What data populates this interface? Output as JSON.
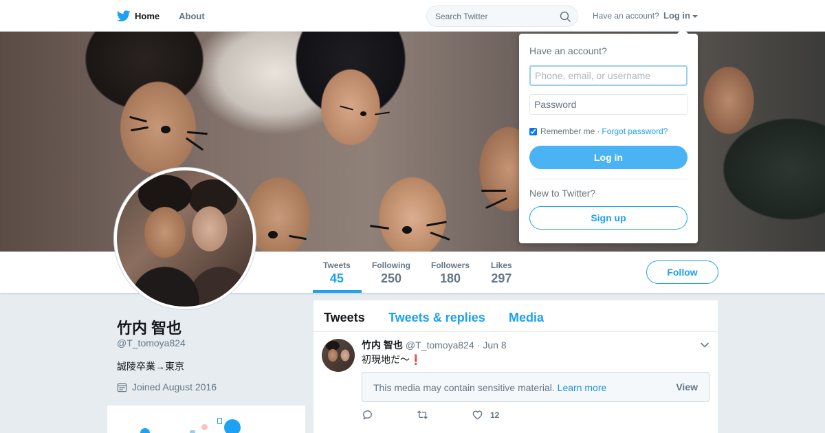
{
  "nav": {
    "home_label": "Home",
    "about_label": "About",
    "search_placeholder": "Search Twitter",
    "have_account": "Have an account?",
    "login_label": "Log in"
  },
  "login_dropdown": {
    "title": "Have an account?",
    "username_placeholder": "Phone, email, or username",
    "password_placeholder": "Password",
    "remember_label": "Remember me",
    "separator": "·",
    "forgot_label": "Forgot password?",
    "login_button": "Log in",
    "new_label": "New to Twitter?",
    "signup_button": "Sign up"
  },
  "profile_nav": {
    "stats": [
      {
        "label": "Tweets",
        "value": "45"
      },
      {
        "label": "Following",
        "value": "250"
      },
      {
        "label": "Followers",
        "value": "180"
      },
      {
        "label": "Likes",
        "value": "297"
      }
    ],
    "follow_button": "Follow"
  },
  "profile": {
    "name": "竹内 智也",
    "handle": "@T_tomoya824",
    "bio": "誠陵卒業→東京",
    "joined": "Joined August 2016"
  },
  "timeline": {
    "tabs": [
      "Tweets",
      "Tweets & replies",
      "Media"
    ]
  },
  "tweet": {
    "name": "竹内 智也",
    "handle": "@T_tomoya824",
    "dot": "·",
    "date": "Jun 8",
    "text": "初現地だ〜",
    "emoji": "❗",
    "sensitive_msg": "This media may contain sensitive material.",
    "learn_more": "Learn more",
    "view_label": "View",
    "like_count": "12"
  },
  "colors": {
    "accent": "#1da1f2",
    "login_button": "#4ab3f4",
    "page_bg": "#e6ecf0"
  }
}
